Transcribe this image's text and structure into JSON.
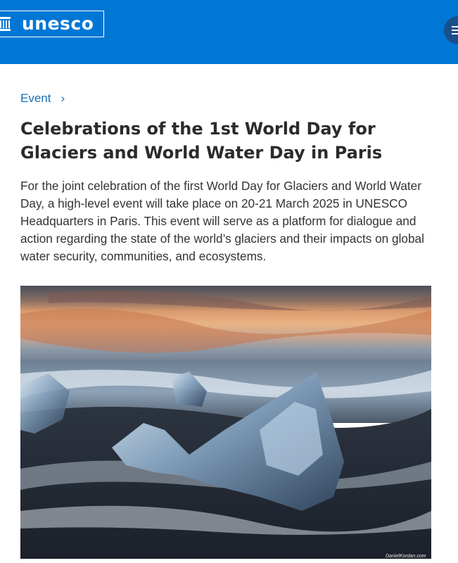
{
  "header": {
    "logo_text": "unesco",
    "logo_icon": "temple-icon",
    "menu_icon": "hamburger-menu-icon",
    "brand_color": "#0077d4"
  },
  "breadcrumb": {
    "label": "Event",
    "chevron": "›"
  },
  "article": {
    "title": "Celebrations of the 1st World Day for Glaciers and World Water Day in Paris",
    "description": "For the joint celebration of the first World Day for Glaciers and World Water Day, a high-level event will take place on 20-21 March 2025 in UNESCO Headquarters in Paris. This event will serve as a platform for dialogue and action regarding the state of the world’s glaciers and their impacts on global water security, communities, and ecosystems."
  },
  "hero_image": {
    "credit": "DanielKordan.com"
  }
}
